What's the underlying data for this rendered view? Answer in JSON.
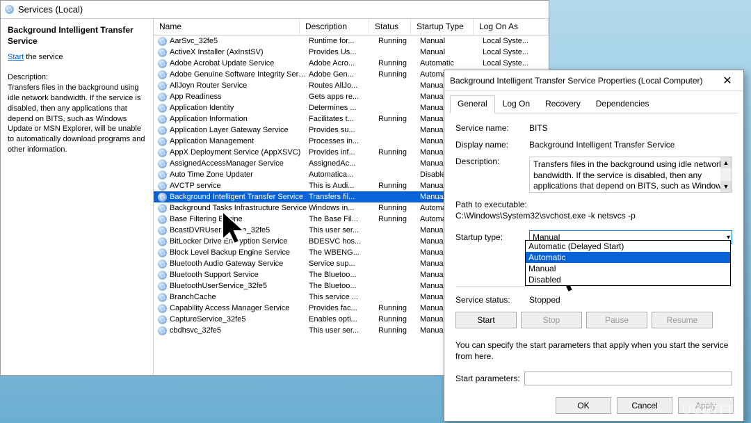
{
  "header": {
    "title": "Services (Local)"
  },
  "leftPanel": {
    "serviceTitle": "Background Intelligent Transfer Service",
    "linkText": "Start",
    "linkSuffix": " the service",
    "descLabel": "Description:",
    "descText": "Transfers files in the background using idle network bandwidth. If the service is disabled, then any applications that depend on BITS, such as Windows Update or MSN Explorer, will be unable to automatically download programs and other information."
  },
  "columns": {
    "name": "Name",
    "desc": "Description",
    "status": "Status",
    "startup": "Startup Type",
    "logon": "Log On As"
  },
  "rows": [
    {
      "name": "AarSvc_32fe5",
      "desc": "Runtime for...",
      "status": "Running",
      "startup": "Manual",
      "logon": "Local Syste..."
    },
    {
      "name": "ActiveX Installer (AxInstSV)",
      "desc": "Provides Us...",
      "status": "",
      "startup": "Manual",
      "logon": "Local Syste..."
    },
    {
      "name": "Adobe Acrobat Update Service",
      "desc": "Adobe Acro...",
      "status": "Running",
      "startup": "Automatic",
      "logon": "Local Syste..."
    },
    {
      "name": "Adobe Genuine Software Integrity Service",
      "desc": "Adobe Gen...",
      "status": "Running",
      "startup": "Automatic",
      "logon": ""
    },
    {
      "name": "AllJoyn Router Service",
      "desc": "Routes AllJo...",
      "status": "",
      "startup": "Manual (Trig...",
      "logon": ""
    },
    {
      "name": "App Readiness",
      "desc": "Gets apps re...",
      "status": "",
      "startup": "Manual",
      "logon": ""
    },
    {
      "name": "Application Identity",
      "desc": "Determines ...",
      "status": "",
      "startup": "Manual (Trig...",
      "logon": ""
    },
    {
      "name": "Application Information",
      "desc": "Facilitates t...",
      "status": "Running",
      "startup": "Manual (Trig...",
      "logon": ""
    },
    {
      "name": "Application Layer Gateway Service",
      "desc": "Provides su...",
      "status": "",
      "startup": "Manual",
      "logon": ""
    },
    {
      "name": "Application Management",
      "desc": "Processes in...",
      "status": "",
      "startup": "Manual",
      "logon": ""
    },
    {
      "name": "AppX Deployment Service (AppXSVC)",
      "desc": "Provides inf...",
      "status": "Running",
      "startup": "Manual (Trig...",
      "logon": ""
    },
    {
      "name": "AssignedAccessManager Service",
      "desc": "AssignedAc...",
      "status": "",
      "startup": "Manual (Trig...",
      "logon": ""
    },
    {
      "name": "Auto Time Zone Updater",
      "desc": "Automatica...",
      "status": "",
      "startup": "Disabled",
      "logon": ""
    },
    {
      "name": "AVCTP service",
      "desc": "This is Audi...",
      "status": "Running",
      "startup": "Manual (Trig...",
      "logon": ""
    },
    {
      "name": "Background Intelligent Transfer Service",
      "desc": "Transfers fil...",
      "status": "",
      "startup": "Manual",
      "logon": "",
      "selected": true
    },
    {
      "name": "Background Tasks Infrastructure Service",
      "desc": "Windows in...",
      "status": "Running",
      "startup": "Automatic",
      "logon": ""
    },
    {
      "name": "Base Filtering Engine",
      "desc": "The Base Fil...",
      "status": "Running",
      "startup": "Automatic",
      "logon": ""
    },
    {
      "name": "BcastDVRUserService_32fe5",
      "desc": "This user ser...",
      "status": "",
      "startup": "Manual",
      "logon": ""
    },
    {
      "name": "BitLocker Drive Encryption Service",
      "desc": "BDESVC hos...",
      "status": "",
      "startup": "Manual (Trig...",
      "logon": ""
    },
    {
      "name": "Block Level Backup Engine Service",
      "desc": "The WBENG...",
      "status": "",
      "startup": "Manual",
      "logon": ""
    },
    {
      "name": "Bluetooth Audio Gateway Service",
      "desc": "Service sup...",
      "status": "",
      "startup": "Manual (Trig...",
      "logon": ""
    },
    {
      "name": "Bluetooth Support Service",
      "desc": "The Bluetoo...",
      "status": "",
      "startup": "Manual (Trig...",
      "logon": ""
    },
    {
      "name": "BluetoothUserService_32fe5",
      "desc": "The Bluetoo...",
      "status": "",
      "startup": "Manual (Trig...",
      "logon": ""
    },
    {
      "name": "BranchCache",
      "desc": "This service ...",
      "status": "",
      "startup": "Manual",
      "logon": ""
    },
    {
      "name": "Capability Access Manager Service",
      "desc": "Provides fac...",
      "status": "Running",
      "startup": "Manual",
      "logon": ""
    },
    {
      "name": "CaptureService_32fe5",
      "desc": "Enables opti...",
      "status": "Running",
      "startup": "Manual",
      "logon": ""
    },
    {
      "name": "cbdhsvc_32fe5",
      "desc": "This user ser...",
      "status": "Running",
      "startup": "Manual",
      "logon": ""
    }
  ],
  "dialog": {
    "title": "Background Intelligent Transfer Service Properties (Local Computer)",
    "tabs": [
      "General",
      "Log On",
      "Recovery",
      "Dependencies"
    ],
    "activeTab": 0,
    "serviceNameLabel": "Service name:",
    "serviceName": "BITS",
    "displayNameLabel": "Display name:",
    "displayName": "Background Intelligent Transfer Service",
    "descriptionLabel": "Description:",
    "description": "Transfers files in the background using idle network bandwidth. If the service is disabled, then any applications that depend on BITS, such as Windows",
    "pathLabel": "Path to executable:",
    "pathValue": "C:\\Windows\\System32\\svchost.exe -k netsvcs -p",
    "startupTypeLabel": "Startup type:",
    "startupTypeValue": "Manual",
    "dropdownOptions": [
      "Automatic (Delayed Start)",
      "Automatic",
      "Manual",
      "Disabled"
    ],
    "dropdownSelected": 1,
    "serviceStatusLabel": "Service status:",
    "serviceStatus": "Stopped",
    "buttons": {
      "start": "Start",
      "stop": "Stop",
      "pause": "Pause",
      "resume": "Resume"
    },
    "note": "You can specify the start parameters that apply when you start the service from here.",
    "startParamsLabel": "Start parameters:",
    "startParamsValue": "",
    "footer": {
      "ok": "OK",
      "cancel": "Cancel",
      "apply": "Apply"
    }
  },
  "watermark": "UGETFIX"
}
